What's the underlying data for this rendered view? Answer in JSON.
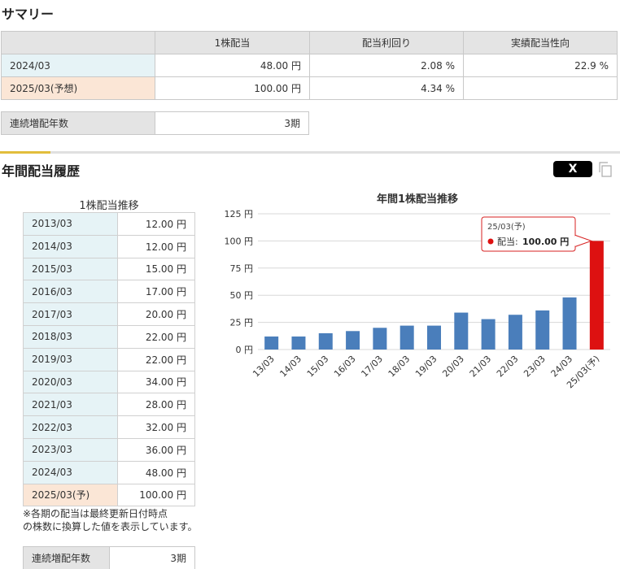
{
  "summary": {
    "title": "サマリー",
    "headers": [
      "",
      "1株配当",
      "配当利回り",
      "実績配当性向"
    ],
    "rows": [
      {
        "label": "2024/03",
        "dividend": "48.00 円",
        "yield": "2.08 %",
        "payout": "22.9 %"
      },
      {
        "label": "2025/03(予想)",
        "dividend": "100.00 円",
        "yield": "4.34 %",
        "payout": ""
      }
    ],
    "streak_label": "連続増配年数",
    "streak_value": "3期"
  },
  "history": {
    "title": "年間配当履歴",
    "share_button": "X",
    "table_title": "1株配当推移",
    "rows": [
      {
        "label": "2013/03",
        "value": "12.00 円"
      },
      {
        "label": "2014/03",
        "value": "12.00 円"
      },
      {
        "label": "2015/03",
        "value": "15.00 円"
      },
      {
        "label": "2016/03",
        "value": "17.00 円"
      },
      {
        "label": "2017/03",
        "value": "20.00 円"
      },
      {
        "label": "2018/03",
        "value": "22.00 円"
      },
      {
        "label": "2019/03",
        "value": "22.00 円"
      },
      {
        "label": "2020/03",
        "value": "34.00 円"
      },
      {
        "label": "2021/03",
        "value": "28.00 円"
      },
      {
        "label": "2022/03",
        "value": "32.00 円"
      },
      {
        "label": "2023/03",
        "value": "36.00 円"
      },
      {
        "label": "2024/03",
        "value": "48.00 円"
      },
      {
        "label": "2025/03(予)",
        "value": "100.00 円"
      }
    ],
    "note_line1": "※各期の配当は最終更新日付時点",
    "note_line2": "の株数に換算した値を表示しています。",
    "streak_label": "連続増配年数",
    "streak_value": "3期"
  },
  "chart_data": {
    "type": "bar",
    "title": "年間1株配当推移",
    "categories": [
      "13/03",
      "14/03",
      "15/03",
      "16/03",
      "17/03",
      "18/03",
      "19/03",
      "20/03",
      "21/03",
      "22/03",
      "23/03",
      "24/03",
      "25/03(予)"
    ],
    "values": [
      12,
      12,
      15,
      17,
      20,
      22,
      22,
      34,
      28,
      32,
      36,
      48,
      100
    ],
    "ylim": [
      0,
      125
    ],
    "yticks": [
      "0 円",
      "25 円",
      "50 円",
      "75 円",
      "100 円",
      "125 円"
    ],
    "grid": true,
    "colors": {
      "actual": "#4a7ebb",
      "forecast": "#dd1111"
    },
    "tooltip": {
      "title": "25/03(予)",
      "label": "配当:",
      "value": "100.00 円"
    }
  }
}
